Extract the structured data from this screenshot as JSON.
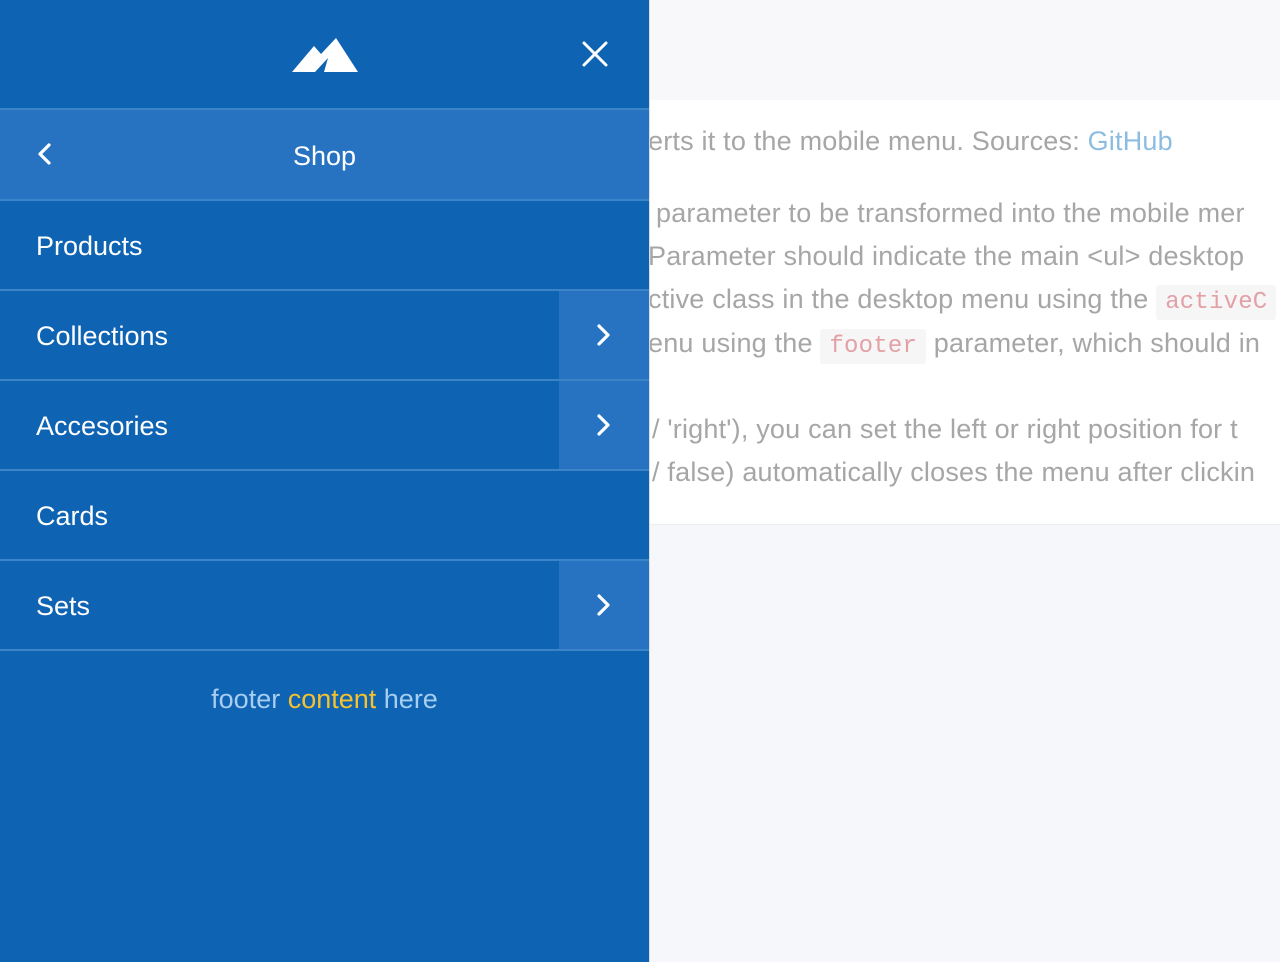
{
  "background": {
    "line1": {
      "text": "erts it to the mobile menu. Sources: ",
      "link": "GitHub"
    },
    "line2": "parameter to be transformed into the mobile mer",
    "line3": "Parameter should indicate the main <ul> desktop",
    "line4": {
      "before": "ctive class in the desktop menu using the ",
      "code": "activeC"
    },
    "line5": {
      "before": "enu using the ",
      "code": "footer",
      "after": " parameter, which should in"
    },
    "line6": "/ 'right'), you can set the left or right position for t",
    "line7": "/ false) automatically closes the menu after clickin"
  },
  "drawer": {
    "logo_icon": "mountain-logo",
    "close_icon": "close-icon",
    "title": "Shop",
    "back_icon": "chevron-left-icon",
    "items": [
      {
        "label": "Products",
        "has_submenu": false
      },
      {
        "label": "Collections",
        "has_submenu": true
      },
      {
        "label": "Accesories",
        "has_submenu": true
      },
      {
        "label": "Cards",
        "has_submenu": false
      },
      {
        "label": "Sets",
        "has_submenu": true
      }
    ],
    "footer": {
      "part1": "footer ",
      "highlight": "content",
      "part2": " here"
    }
  },
  "colors": {
    "drawer_bg": "#0e63b3",
    "drawer_active": "#2773c1",
    "footer_text": "#a7cdf0",
    "footer_highlight": "#f5c12d",
    "link": "#8cbde0",
    "code_text": "#e3a0a6"
  }
}
